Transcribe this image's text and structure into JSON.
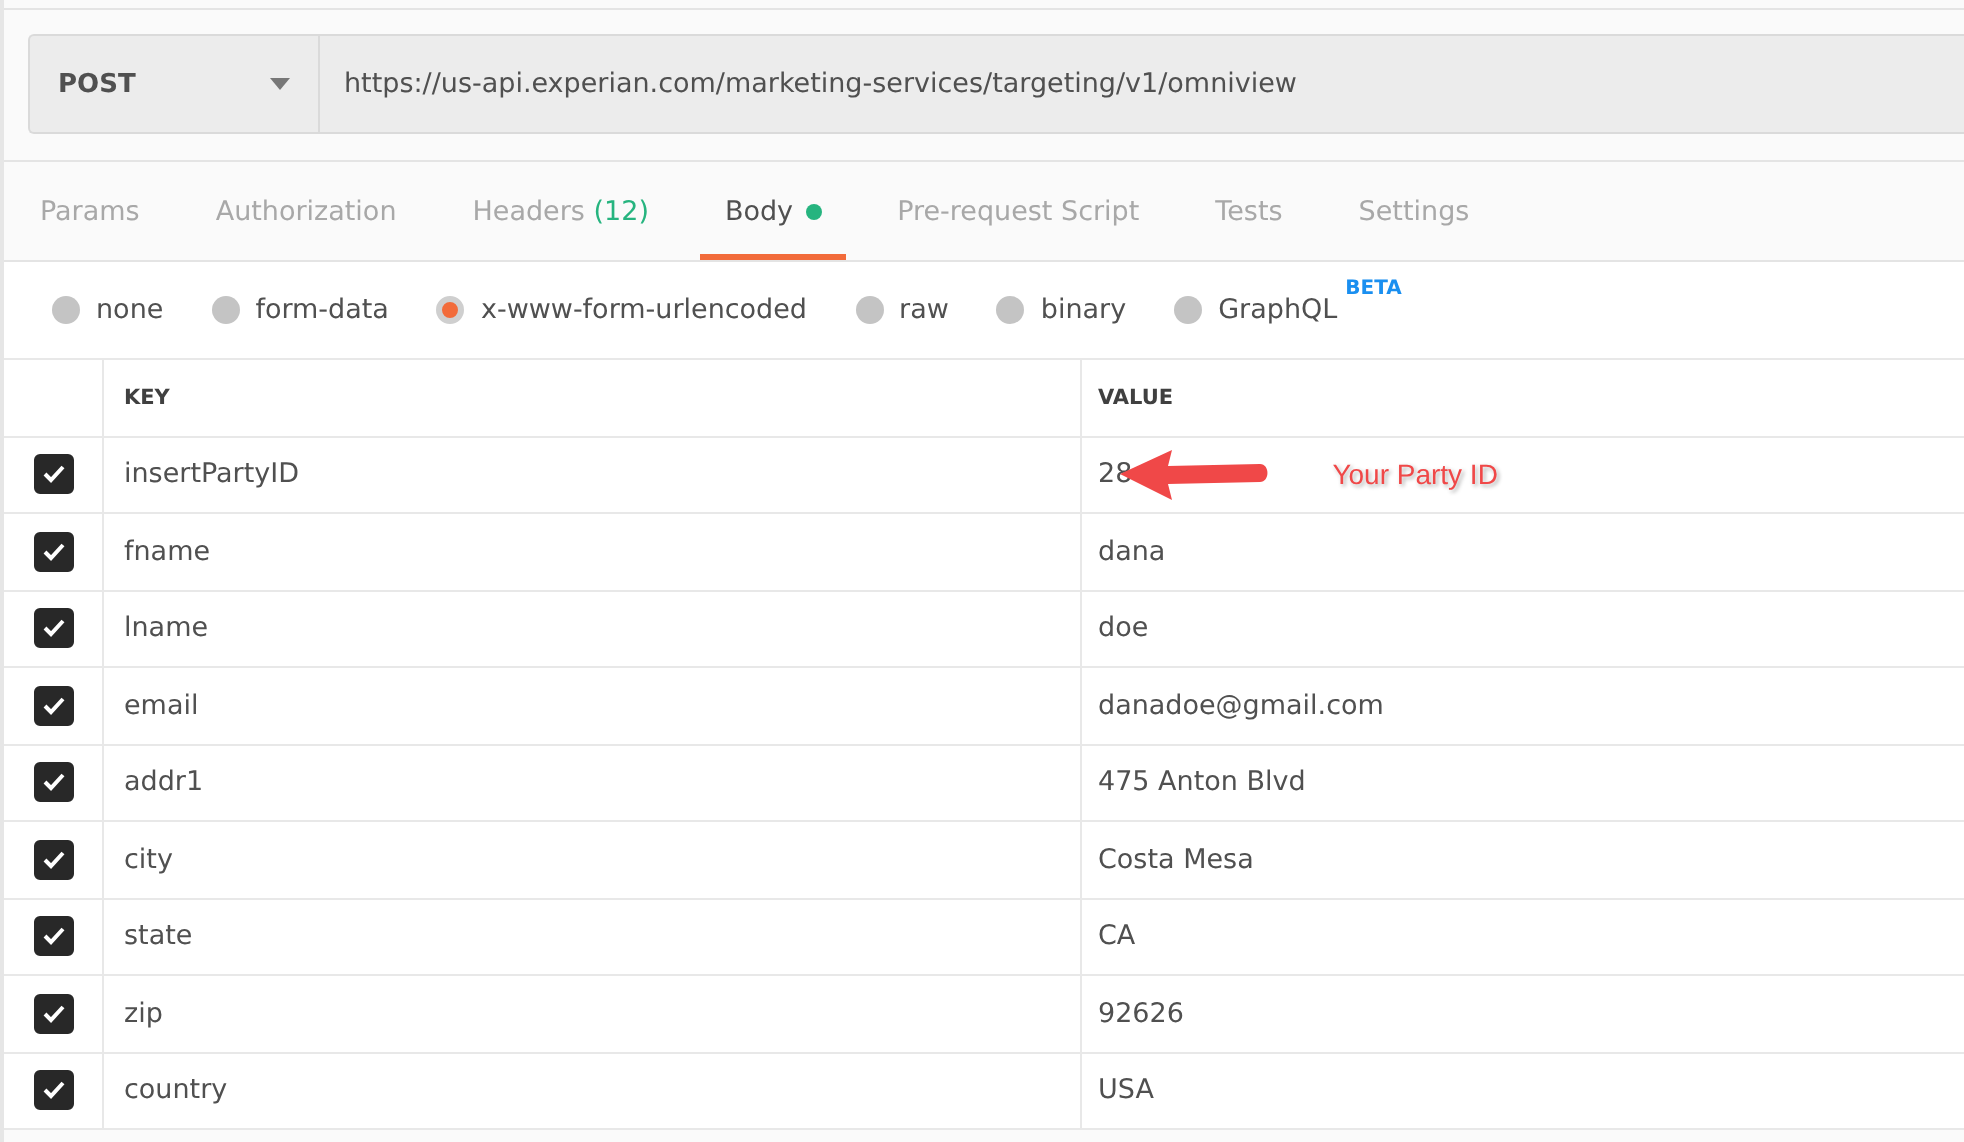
{
  "request": {
    "method": "POST",
    "url": "https://us-api.experian.com/marketing-services/targeting/v1/omniview"
  },
  "tabs": [
    {
      "label": "Params",
      "selected": false
    },
    {
      "label": "Authorization",
      "selected": false
    },
    {
      "label": "Headers",
      "count": "(12)",
      "selected": false
    },
    {
      "label": "Body",
      "dot": true,
      "selected": true
    },
    {
      "label": "Pre-request Script",
      "selected": false
    },
    {
      "label": "Tests",
      "selected": false
    },
    {
      "label": "Settings",
      "selected": false
    }
  ],
  "body_types": [
    {
      "label": "none",
      "selected": false
    },
    {
      "label": "form-data",
      "selected": false
    },
    {
      "label": "x-www-form-urlencoded",
      "selected": true
    },
    {
      "label": "raw",
      "selected": false
    },
    {
      "label": "binary",
      "selected": false
    },
    {
      "label": "GraphQL",
      "badge": "BETA",
      "selected": false
    }
  ],
  "table": {
    "columns": [
      "KEY",
      "VALUE"
    ],
    "rows": [
      {
        "key": "insertPartyID",
        "value": "28",
        "checked": true,
        "annotation": "Your Party ID"
      },
      {
        "key": "fname",
        "value": "dana",
        "checked": true
      },
      {
        "key": "lname",
        "value": "doe",
        "checked": true
      },
      {
        "key": "email",
        "value": "danadoe@gmail.com",
        "checked": true
      },
      {
        "key": "addr1",
        "value": "475 Anton Blvd",
        "checked": true
      },
      {
        "key": "city",
        "value": "Costa Mesa",
        "checked": true
      },
      {
        "key": "state",
        "value": "CA",
        "checked": true
      },
      {
        "key": "zip",
        "value": "92626",
        "checked": true
      },
      {
        "key": "country",
        "value": "USA",
        "checked": true
      }
    ]
  }
}
